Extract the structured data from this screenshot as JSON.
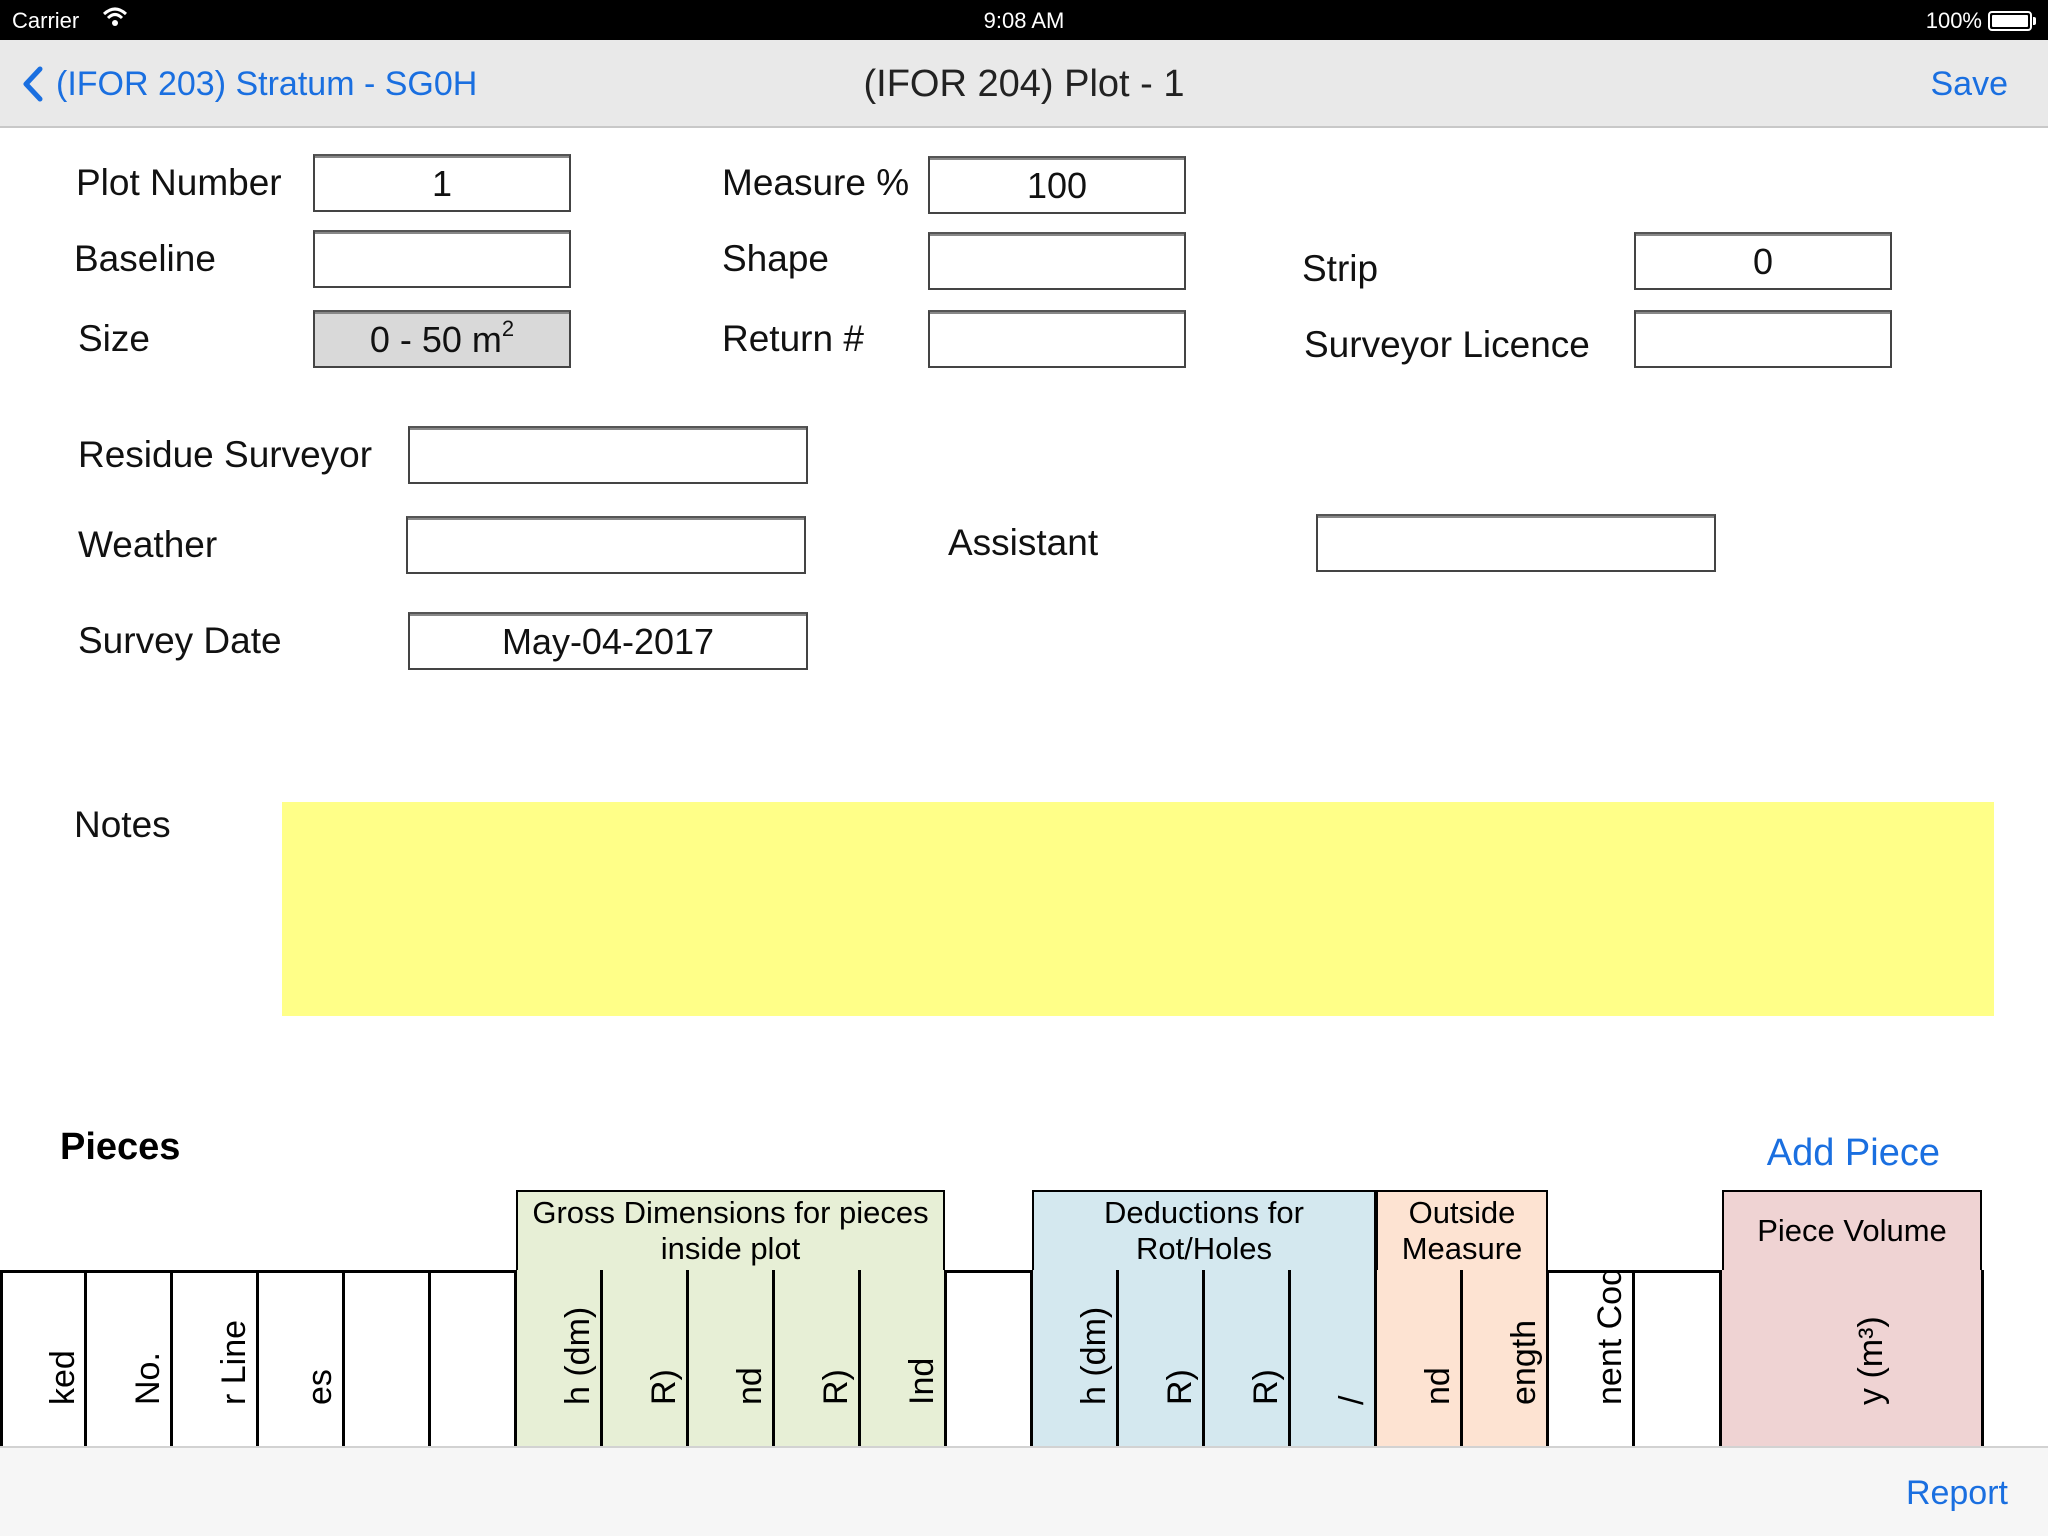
{
  "status_bar": {
    "carrier": "Carrier",
    "time": "9:08 AM",
    "battery": "100%"
  },
  "nav": {
    "back_label": "(IFOR 203) Stratum - SG0H",
    "title": "(IFOR 204) Plot - 1",
    "save_label": "Save"
  },
  "form": {
    "plot_number": {
      "label": "Plot Number",
      "value": "1"
    },
    "measure_pct": {
      "label": "Measure %",
      "value": "100"
    },
    "baseline": {
      "label": "Baseline",
      "value": ""
    },
    "shape": {
      "label": "Shape",
      "value": ""
    },
    "strip": {
      "label": "Strip",
      "value": "0"
    },
    "size": {
      "label": "Size",
      "value": "0 - 50 m",
      "sup": "2"
    },
    "return_no": {
      "label": "Return #",
      "value": ""
    },
    "surveyor_licence": {
      "label": "Surveyor Licence",
      "value": ""
    },
    "residue_surveyor": {
      "label": "Residue Surveyor",
      "value": ""
    },
    "weather": {
      "label": "Weather",
      "value": ""
    },
    "assistant": {
      "label": "Assistant",
      "value": ""
    },
    "survey_date": {
      "label": "Survey Date",
      "value": "May-04-2017"
    },
    "notes": {
      "label": "Notes",
      "value": ""
    }
  },
  "pieces": {
    "title": "Pieces",
    "add_label": "Add Piece",
    "groups": {
      "gross": "Gross Dimensions for pieces inside plot",
      "deductions": "Deductions for Rot/Holes",
      "outside": "Outside Measure",
      "volume": "Piece Volume"
    },
    "columns": [
      "ked",
      "No.",
      "r Line",
      "es",
      "",
      "",
      "h (dm)",
      "R)",
      "nd",
      "R)",
      "Ind",
      "",
      "h (dm)",
      "R)",
      "R)",
      "/",
      "nd",
      "ength",
      "nent Code",
      "",
      "y (m³)"
    ]
  },
  "toolbar": {
    "report_label": "Report"
  },
  "colors": {
    "accent": "#1a6fe0",
    "notes_bg": "#ffff88",
    "gross_bg": "#e7efd6",
    "deductions_bg": "#d4e8ef",
    "outside_bg": "#fde3d2",
    "volume_bg": "#efd3d3"
  }
}
